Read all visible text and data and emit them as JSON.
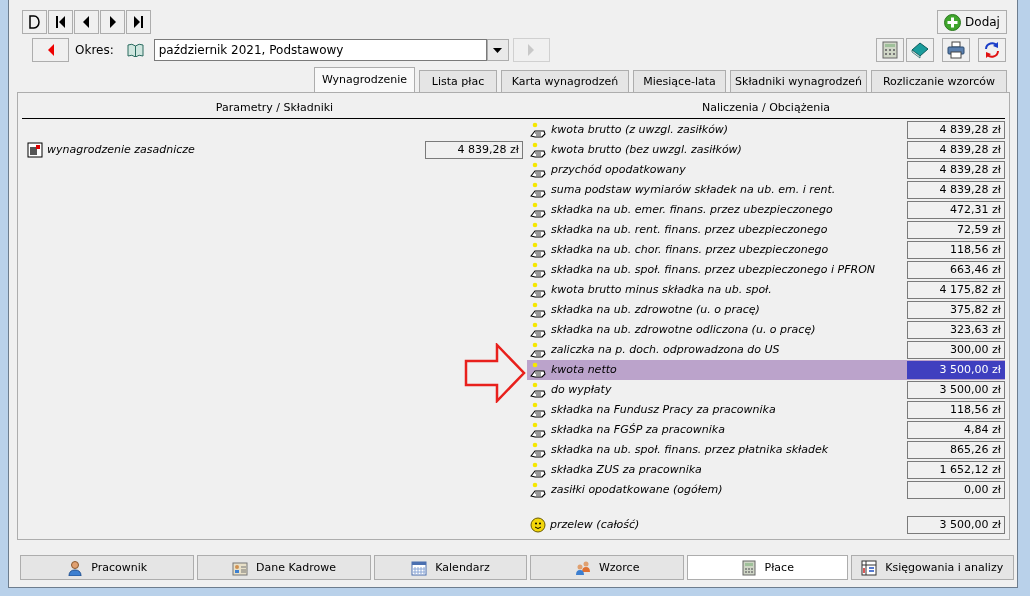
{
  "period": {
    "label": "Okres:",
    "value": "październik 2021, Podstawowy",
    "prev_disabled": false,
    "next_disabled": true
  },
  "add_button": "Dodaj",
  "tabs": [
    {
      "label": "Wynagrodzenie",
      "selected": true
    },
    {
      "label": "Lista płac",
      "selected": false
    },
    {
      "label": "Karta wynagrodzeń",
      "selected": false
    },
    {
      "label": "Miesiące-lata",
      "selected": false
    },
    {
      "label": "Składniki wynagrodzeń",
      "selected": false
    },
    {
      "label": "Rozliczanie wzorców",
      "selected": false
    }
  ],
  "left_header": "Parametry / Składniki",
  "right_header": "Naliczenia / Obciążenia",
  "components": [
    {
      "label": "wynagrodzenie zasadnicze",
      "value": "4 839,28 zł"
    }
  ],
  "charges": [
    {
      "label": "kwota brutto (z uwzgl. zasiłków)",
      "value": "4 839,28 zł",
      "selected": false
    },
    {
      "label": "kwota brutto (bez uwzgl. zasiłków)",
      "value": "4 839,28 zł",
      "selected": false
    },
    {
      "label": "przychód opodatkowany",
      "value": "4 839,28 zł",
      "selected": false
    },
    {
      "label": "suma podstaw wymiarów składek na ub. em. i rent.",
      "value": "4 839,28 zł",
      "selected": false
    },
    {
      "label": "składka na ub. emer. finans. przez ubezpieczonego",
      "value": "472,31 zł",
      "selected": false
    },
    {
      "label": "składka na ub. rent. finans. przez ubezpieczonego",
      "value": "72,59 zł",
      "selected": false
    },
    {
      "label": "składka na ub. chor. finans. przez ubezpieczonego",
      "value": "118,56 zł",
      "selected": false
    },
    {
      "label": "składka na ub. społ. finans. przez ubezpieczonego i PFRON",
      "value": "663,46 zł",
      "selected": false
    },
    {
      "label": "kwota brutto minus składka na ub. społ.",
      "value": "4 175,82 zł",
      "selected": false
    },
    {
      "label": "składka na ub. zdrowotne (u. o pracę)",
      "value": "375,82 zł",
      "selected": false
    },
    {
      "label": "składka na ub. zdrowotne odliczona (u. o pracę)",
      "value": "323,63 zł",
      "selected": false
    },
    {
      "label": "zaliczka na p. doch. odprowadzona do US",
      "value": "300,00 zł",
      "selected": false
    },
    {
      "label": "kwota netto",
      "value": "3 500,00 zł",
      "selected": true
    },
    {
      "label": "do wypłaty",
      "value": "3 500,00 zł",
      "selected": false
    },
    {
      "label": "składka na Fundusz Pracy za pracownika",
      "value": "118,56 zł",
      "selected": false
    },
    {
      "label": "składka na FGŚP za pracownika",
      "value": "4,84 zł",
      "selected": false
    },
    {
      "label": "składka na ub. społ. finans. przez płatnika składek",
      "value": "865,26 zł",
      "selected": false
    },
    {
      "label": "składka ZUS za pracownika",
      "value": "1 652,12 zł",
      "selected": false
    },
    {
      "label": "zasiłki opodatkowane (ogółem)",
      "value": "0,00 zł",
      "selected": false
    }
  ],
  "total": {
    "label": "przelew (całość)",
    "value": "3 500,00 zł"
  },
  "bottom_tabs": [
    {
      "label": "Pracownik",
      "selected": false
    },
    {
      "label": "Dane Kadrowe",
      "selected": false
    },
    {
      "label": "Kalendarz",
      "selected": false
    },
    {
      "label": "Wzorce",
      "selected": false
    },
    {
      "label": "Płace",
      "selected": true
    },
    {
      "label": "Księgowania i analizy",
      "selected": false
    }
  ]
}
